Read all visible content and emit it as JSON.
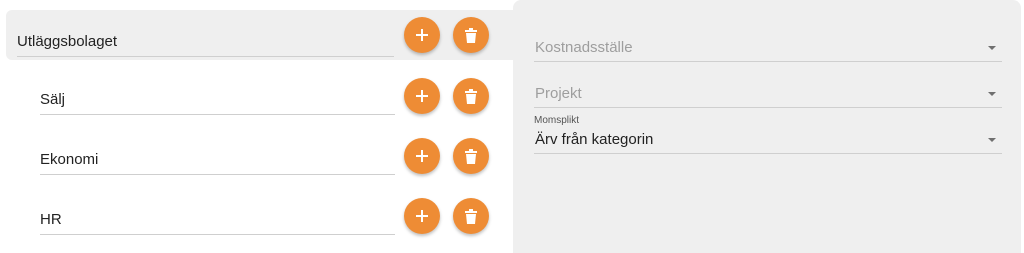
{
  "tree": {
    "items": [
      {
        "name": "Utläggsbolaget",
        "level": 0,
        "selected": true
      },
      {
        "name": "Sälj",
        "level": 1,
        "selected": false
      },
      {
        "name": "Ekonomi",
        "level": 1,
        "selected": false
      },
      {
        "name": "HR",
        "level": 1,
        "selected": false
      }
    ],
    "add_icon": "plus-icon",
    "delete_icon": "trash-icon",
    "button_color": "#EE8C35"
  },
  "details": {
    "cost_center": {
      "placeholder": "Kostnadsställe",
      "value": ""
    },
    "project": {
      "placeholder": "Projekt",
      "value": ""
    },
    "vat": {
      "label": "Momsplikt",
      "value": "Ärv från kategorin"
    }
  }
}
